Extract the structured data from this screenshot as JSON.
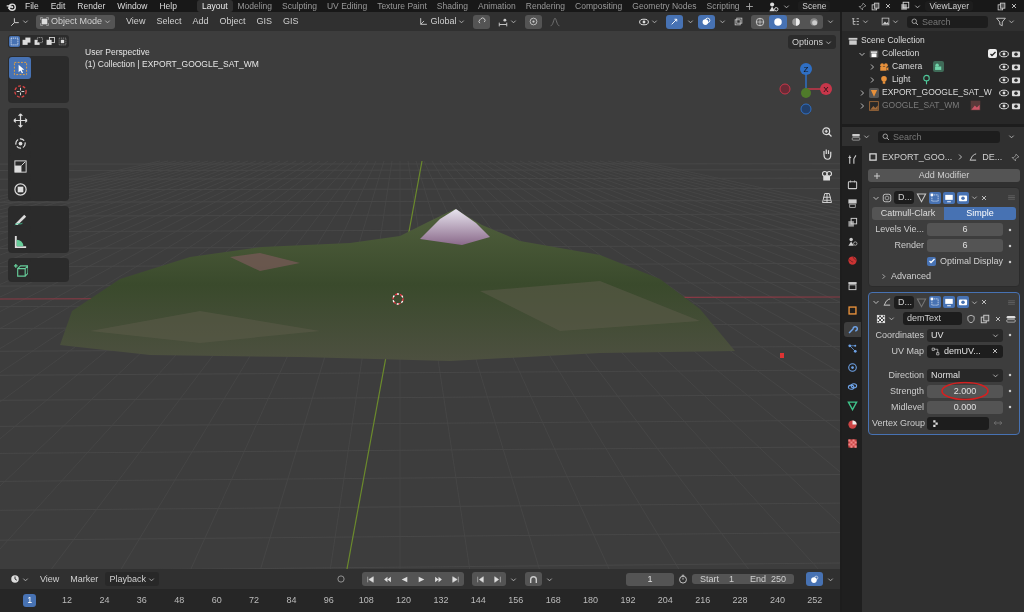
{
  "top_menu": [
    "File",
    "Edit",
    "Render",
    "Window",
    "Help"
  ],
  "workspaces": [
    {
      "label": "Layout",
      "selected": true
    },
    {
      "label": "Modeling",
      "selected": false
    },
    {
      "label": "Sculpting",
      "selected": false
    },
    {
      "label": "UV Editing",
      "selected": false
    },
    {
      "label": "Texture Paint",
      "selected": false
    },
    {
      "label": "Shading",
      "selected": false
    },
    {
      "label": "Animation",
      "selected": false
    },
    {
      "label": "Rendering",
      "selected": false
    },
    {
      "label": "Compositing",
      "selected": false
    },
    {
      "label": "Geometry Nodes",
      "selected": false
    },
    {
      "label": "Scripting",
      "selected": false
    }
  ],
  "scene": "Scene",
  "view_layer": "ViewLayer",
  "viewport": {
    "mode": "Object Mode",
    "menus": [
      "View",
      "Select",
      "Add",
      "Object",
      "GIS",
      "GIS"
    ],
    "orientation": "Global",
    "shading": [
      {
        "kind": "wireframe",
        "selected": false
      },
      {
        "kind": "solid",
        "selected": true
      },
      {
        "kind": "material",
        "selected": false
      },
      {
        "kind": "rendered",
        "selected": false
      }
    ],
    "select_modes": [
      {
        "kind": "new",
        "selected": true
      },
      {
        "kind": "extend",
        "selected": false
      },
      {
        "kind": "subtract",
        "selected": false
      },
      {
        "kind": "invert",
        "selected": false
      },
      {
        "kind": "intersect",
        "selected": false
      }
    ],
    "options": "Options",
    "overlay_lines": [
      "User Perspective",
      "(1) Collection | EXPORT_GOOGLE_SAT_WM"
    ],
    "tool_groups": [
      [
        {
          "kind": "select",
          "selected": true
        },
        {
          "kind": "cursor",
          "selected": false
        }
      ],
      [
        {
          "kind": "move",
          "selected": false
        },
        {
          "kind": "rotate",
          "selected": false
        },
        {
          "kind": "scale",
          "selected": false
        },
        {
          "kind": "transform",
          "selected": false
        }
      ],
      [
        {
          "kind": "annotate",
          "selected": false
        },
        {
          "kind": "measure",
          "selected": false
        }
      ],
      [
        {
          "kind": "add_cube",
          "selected": false
        }
      ]
    ],
    "gizmo": [
      {
        "label": "Z",
        "color": "#2f6fc4"
      },
      {
        "label": "X",
        "color": "#c8364a"
      }
    ]
  },
  "outliner": {
    "search_placeholder": "Search",
    "tree": [
      {
        "label": "Scene Collection",
        "kind": "scene",
        "children": [
          {
            "label": "Collection",
            "kind": "collection",
            "expanded": true,
            "checked": true,
            "disabled": false,
            "children": [
              {
                "label": "Camera",
                "kind": "camera",
                "expanded": false,
                "disabled": false
              },
              {
                "label": "Light",
                "kind": "light",
                "expanded": false,
                "disabled": false
              }
            ]
          },
          {
            "label": "EXPORT_GOOGLE_SAT_W",
            "kind": "mesh",
            "expanded": false,
            "disabled": false
          },
          {
            "label": "GOOGLE_SAT_WM",
            "kind": "image",
            "expanded": false,
            "disabled": true
          }
        ]
      }
    ]
  },
  "properties": {
    "search_placeholder": "Search",
    "tabs": [
      {
        "kind": "tool",
        "selected": false
      },
      {
        "kind": "render",
        "selected": false
      },
      {
        "kind": "output",
        "selected": false
      },
      {
        "kind": "view_layer",
        "selected": false
      },
      {
        "kind": "scene",
        "selected": false
      },
      {
        "kind": "world",
        "selected": false
      },
      {
        "kind": "collection",
        "selected": false
      },
      {
        "kind": "object",
        "selected": false
      },
      {
        "kind": "modifier",
        "selected": true
      },
      {
        "kind": "particles",
        "selected": false
      },
      {
        "kind": "physics",
        "selected": false
      },
      {
        "kind": "constraints",
        "selected": false
      },
      {
        "kind": "data",
        "selected": false
      },
      {
        "kind": "material",
        "selected": false
      },
      {
        "kind": "texture",
        "selected": false
      }
    ],
    "breadcrumb": [
      "EXPORT_GOO...",
      "DE..."
    ],
    "add_modifier": "Add Modifier",
    "modifiers": [
      {
        "kind": "subdivision",
        "name": "D...",
        "expanded": true,
        "active": false,
        "types": [
          {
            "label": "Catmull-Clark",
            "selected": false
          },
          {
            "label": "Simple",
            "selected": true
          }
        ],
        "fields": [
          {
            "label": "Levels Vie...",
            "value": "6"
          },
          {
            "label": "Render",
            "value": "6"
          }
        ],
        "optimal_display": {
          "label": "Optimal Display",
          "checked": true
        },
        "advanced": {
          "label": "Advanced",
          "expanded": false
        }
      },
      {
        "kind": "displace",
        "name": "D...",
        "expanded": true,
        "active": true,
        "texture": "demText",
        "fields": [
          {
            "kind": "dropdown",
            "label": "Coordinates",
            "value": "UV"
          },
          {
            "kind": "uvmap",
            "label": "UV Map",
            "value": "demUV..."
          },
          {
            "kind": "dropdown",
            "label": "Direction",
            "value": "Normal"
          },
          {
            "kind": "number",
            "label": "Strength",
            "value": "2.000",
            "highlighted": true
          },
          {
            "kind": "number",
            "label": "Midlevel",
            "value": "0.000",
            "highlighted": false
          },
          {
            "kind": "group",
            "label": "Vertex Group"
          }
        ]
      }
    ]
  },
  "timeline": {
    "menus": [
      "View",
      "Marker"
    ],
    "playback": "Playback",
    "current_frame": "1",
    "start_label": "Start",
    "start": "1",
    "end_label": "End",
    "end": "250",
    "ruler": [
      {
        "label": "1",
        "selected": true
      },
      {
        "label": "12",
        "selected": false
      },
      {
        "label": "24",
        "selected": false
      },
      {
        "label": "36",
        "selected": false
      },
      {
        "label": "48",
        "selected": false
      },
      {
        "label": "60",
        "selected": false
      },
      {
        "label": "72",
        "selected": false
      },
      {
        "label": "84",
        "selected": false
      },
      {
        "label": "96",
        "selected": false
      },
      {
        "label": "108",
        "selected": false
      },
      {
        "label": "120",
        "selected": false
      },
      {
        "label": "132",
        "selected": false
      },
      {
        "label": "144",
        "selected": false
      },
      {
        "label": "156",
        "selected": false
      },
      {
        "label": "168",
        "selected": false
      },
      {
        "label": "180",
        "selected": false
      },
      {
        "label": "192",
        "selected": false
      },
      {
        "label": "204",
        "selected": false
      },
      {
        "label": "216",
        "selected": false
      },
      {
        "label": "228",
        "selected": false
      },
      {
        "label": "240",
        "selected": false
      },
      {
        "label": "252",
        "selected": false
      }
    ]
  }
}
